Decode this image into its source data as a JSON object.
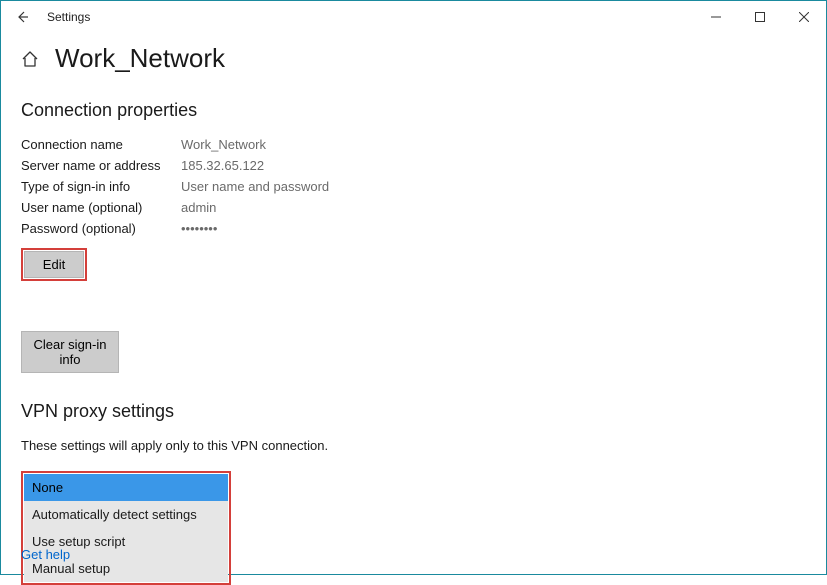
{
  "window": {
    "title": "Settings"
  },
  "page": {
    "title": "Work_Network"
  },
  "connection_properties": {
    "heading": "Connection properties",
    "rows": {
      "name": {
        "label": "Connection name",
        "value": "Work_Network"
      },
      "server": {
        "label": "Server name or address",
        "value": "185.32.65.122"
      },
      "signin_type": {
        "label": "Type of sign-in info",
        "value": "User name and password"
      },
      "username": {
        "label": "User name (optional)",
        "value": "admin"
      },
      "password": {
        "label": "Password (optional)",
        "value": "••••••••"
      }
    },
    "edit_label": "Edit",
    "clear_label": "Clear sign-in info"
  },
  "proxy": {
    "heading": "VPN proxy settings",
    "description": "These settings will apply only to this VPN connection.",
    "options": {
      "none": "None",
      "auto": "Automatically detect settings",
      "script": "Use setup script",
      "manual": "Manual setup"
    }
  },
  "help_link": "Get help"
}
